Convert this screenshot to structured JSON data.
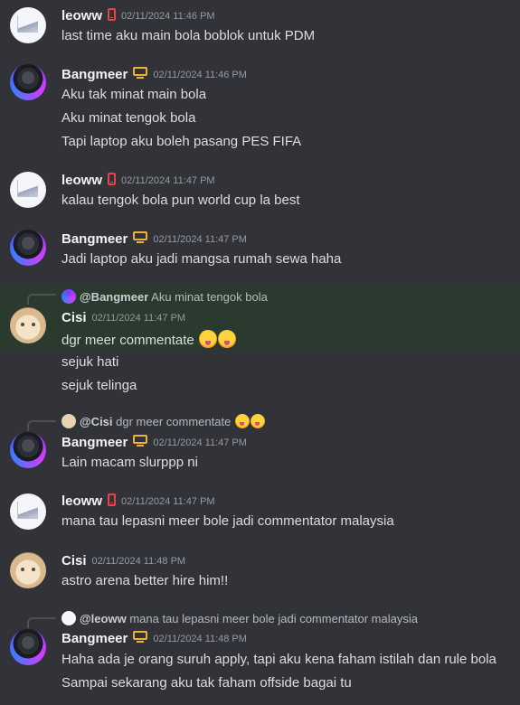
{
  "users": {
    "leoww": {
      "name": "leoww",
      "badge": "phone-icon"
    },
    "bangmeer": {
      "name": "Bangmeer",
      "badge": "monitor-icon"
    },
    "cisi": {
      "name": "Cisi",
      "badge": ""
    }
  },
  "messages": [
    {
      "author": "leoww",
      "time": "02/11/2024 11:46 PM",
      "lines": [
        "last time aku main bola boblok untuk PDM"
      ]
    },
    {
      "author": "Bangmeer",
      "time": "02/11/2024 11:46 PM",
      "lines": [
        "Aku tak minat main bola",
        "Aku minat tengok bola",
        "Tapi laptop aku boleh pasang PES FIFA"
      ]
    },
    {
      "author": "leoww",
      "time": "02/11/2024 11:47 PM",
      "lines": [
        "kalau tengok bola pun world cup la best"
      ]
    },
    {
      "author": "Bangmeer",
      "time": "02/11/2024 11:47 PM",
      "lines": [
        "Jadi laptop aku jadi mangsa rumah sewa haha"
      ]
    },
    {
      "author": "Cisi",
      "time": "02/11/2024 11:47 PM",
      "reply": {
        "who": "@Bangmeer",
        "text": "Aku minat tengok bola"
      },
      "lines": [
        "dgr meer commentate",
        "sejuk hati",
        "sejuk telinga"
      ]
    },
    {
      "author": "Bangmeer",
      "time": "02/11/2024 11:47 PM",
      "reply": {
        "who": "@Cisi",
        "text": "dgr meer commentate"
      },
      "lines": [
        "Lain macam slurppp ni"
      ]
    },
    {
      "author": "leoww",
      "time": "02/11/2024 11:47 PM",
      "lines": [
        "mana tau lepasni meer bole jadi commentator malaysia"
      ]
    },
    {
      "author": "Cisi",
      "time": "02/11/2024 11:48 PM",
      "lines": [
        "astro arena better hire him!!"
      ]
    },
    {
      "author": "Bangmeer",
      "time": "02/11/2024 11:48 PM",
      "reply": {
        "who": "@leoww",
        "text": "mana tau lepasni meer bole jadi commentator malaysia"
      },
      "lines": [
        "Haha ada je orang suruh apply, tapi aku kena faham istilah dan rule bola",
        "Sampai sekarang aku tak faham offside bagai tu"
      ]
    }
  ],
  "emoji": {
    "name": "yum-emoji"
  }
}
